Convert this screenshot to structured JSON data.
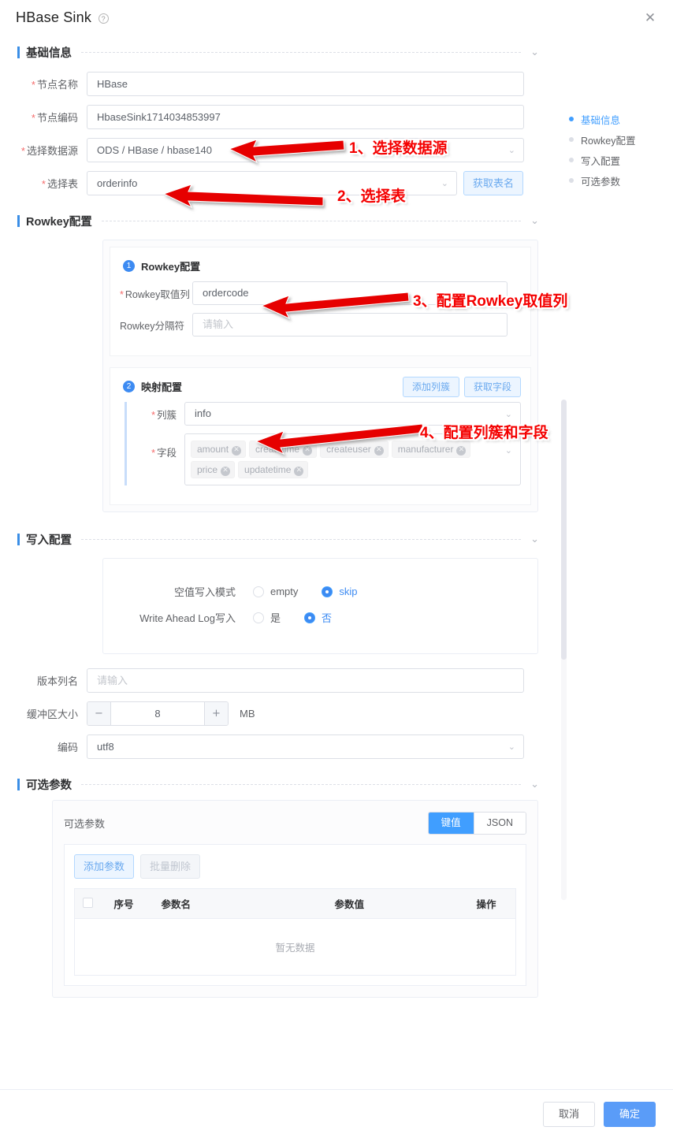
{
  "dialog": {
    "title": "HBase Sink",
    "help_icon": "question-icon",
    "close_icon": "close-icon"
  },
  "anchors": [
    {
      "label": "基础信息",
      "active": true
    },
    {
      "label": "Rowkey配置",
      "active": false
    },
    {
      "label": "写入配置",
      "active": false
    },
    {
      "label": "可选参数",
      "active": false
    }
  ],
  "sections": {
    "basic": {
      "title": "基础信息",
      "fields": {
        "node_name": {
          "label": "节点名称",
          "value": "HBase",
          "required": true
        },
        "node_code": {
          "label": "节点编码",
          "value": "HbaseSink1714034853997",
          "required": true
        },
        "datasource": {
          "label": "选择数据源",
          "value": "ODS / HBase / hbase140",
          "required": true
        },
        "table": {
          "label": "选择表",
          "value": "orderinfo",
          "required": true,
          "button": "获取表名"
        }
      }
    },
    "rowkey": {
      "title": "Rowkey配置",
      "card1": {
        "number": "1",
        "title": "Rowkey配置",
        "rowkey_column": {
          "label": "Rowkey取值列",
          "value": "ordercode",
          "required": true
        },
        "rowkey_separator": {
          "label": "Rowkey分隔符",
          "value": "",
          "placeholder": "请输入",
          "required": false
        }
      },
      "card2": {
        "number": "2",
        "title": "映射配置",
        "add_family_button": "添加列簇",
        "fetch_fields_button": "获取字段",
        "column_family": {
          "label": "列簇",
          "value": "info",
          "required": true
        },
        "fields": {
          "label": "字段",
          "required": true,
          "tags": [
            "amount",
            "createtime",
            "createuser",
            "manufacturer",
            "price",
            "updatetime"
          ]
        }
      }
    },
    "write": {
      "title": "写入配置",
      "null_write_mode": {
        "label": "空值写入模式",
        "options": [
          "empty",
          "skip"
        ],
        "selected": "skip"
      },
      "wal_write": {
        "label": "Write Ahead Log写入",
        "options": [
          "是",
          "否"
        ],
        "selected": "否"
      },
      "version_column": {
        "label": "版本列名",
        "value": "",
        "placeholder": "请输入"
      },
      "buffer_size": {
        "label": "缓冲区大小",
        "value": "8",
        "unit": "MB",
        "minus": "−",
        "plus": "+"
      },
      "encoding": {
        "label": "编码",
        "value": "utf8"
      }
    },
    "optional": {
      "title": "可选参数",
      "card_title": "可选参数",
      "tabs": [
        {
          "label": "键值",
          "active": true
        },
        {
          "label": "JSON",
          "active": false
        }
      ],
      "add_param_button": "添加参数",
      "batch_delete_button": "批量删除",
      "table": {
        "headers": [
          "",
          "序号",
          "参数名",
          "参数值",
          "操作"
        ],
        "empty_text": "暂无数据"
      }
    }
  },
  "footer": {
    "cancel": "取消",
    "confirm": "确定"
  },
  "annotations": [
    {
      "text": "1、选择数据源"
    },
    {
      "text": "2、选择表"
    },
    {
      "text": "3、配置Rowkey取值列"
    },
    {
      "text": "4、配置列簇和字段"
    }
  ],
  "colors": {
    "accent": "#409eff",
    "primary_button": "#5a9cf8",
    "required_star": "#f56c6c",
    "annotation": "#f40000"
  }
}
